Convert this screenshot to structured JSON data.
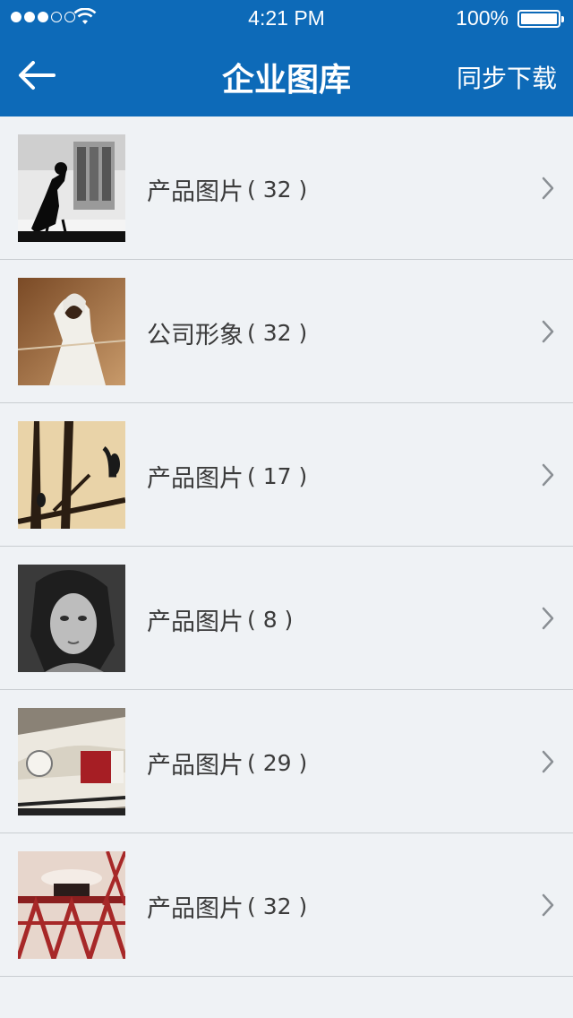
{
  "status_bar": {
    "time": "4:21 PM",
    "battery": "100%",
    "signal_filled": 3,
    "signal_total": 5
  },
  "nav": {
    "title": "企业图库",
    "sync_label": "同步下载",
    "back_icon": "arrow-left-icon"
  },
  "albums": [
    {
      "name": "产品图片",
      "count": "( 32 )",
      "thumb": "silhouette-photographer"
    },
    {
      "name": "公司形象",
      "count": "( 32 )",
      "thumb": "girl-portrait"
    },
    {
      "name": "产品图片",
      "count": "( 17 )",
      "thumb": "birds-on-branches"
    },
    {
      "name": "产品图片",
      "count": "( 8 )",
      "thumb": "woman-bw-portrait"
    },
    {
      "name": "产品图片",
      "count": "( 29 )",
      "thumb": "vintage-race-car"
    },
    {
      "name": "产品图片",
      "count": "( 32 )",
      "thumb": "train-on-bridge"
    }
  ],
  "colors": {
    "header": "#0d6ab8",
    "background": "#eff2f5",
    "divider": "#c9cdd1",
    "text": "#3b3b3b"
  }
}
